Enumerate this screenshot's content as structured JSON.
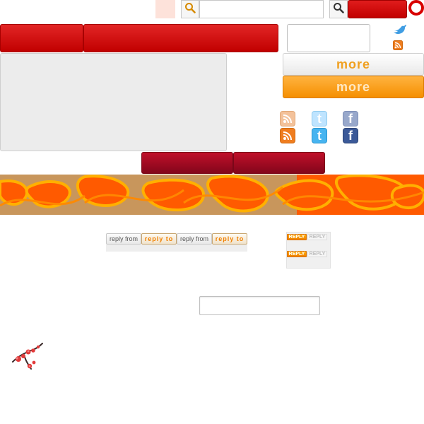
{
  "buttons": {
    "more_white": "more",
    "more_orange": "more"
  },
  "comments": {
    "reply_from_1": "reply from",
    "reply_to_1": "reply to",
    "reply_from_2": "reply from",
    "reply_to_2": "reply to",
    "reply_badges": [
      {
        "on": "REPLY",
        "off": "REPLY"
      },
      {
        "on": "REPLY",
        "off": "REPLY"
      }
    ]
  },
  "icons": {
    "search": "search-icon",
    "twitter_bird": "twitter-bird-icon",
    "rss": "rss-icon",
    "facebook": "facebook-icon",
    "twitter": "twitter-icon",
    "blossom": "plum-blossom-icon"
  },
  "colors": {
    "accent_red": "#d80000",
    "maroon": "#a00d24",
    "orange": "#ff9a1f",
    "banner_orange": "#ff5a00"
  }
}
